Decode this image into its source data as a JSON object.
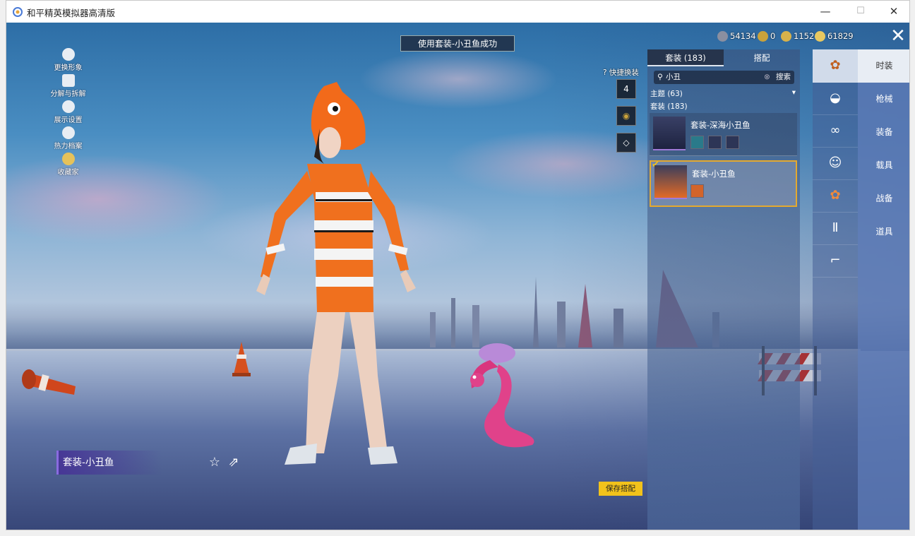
{
  "window": {
    "title": "和平精英模拟器高清版",
    "minimize": "—",
    "maximize": "☐",
    "close": "✕"
  },
  "side_menu": [
    {
      "label": "更换形象",
      "icon": "person-icon"
    },
    {
      "label": "分解与拆解",
      "icon": "puzzle-icon"
    },
    {
      "label": "展示设置",
      "icon": "eye-icon"
    },
    {
      "label": "热力档案",
      "icon": "flame-icon"
    },
    {
      "label": "收藏家",
      "icon": "medal-icon"
    }
  ],
  "notice": "使用套装-小丑鱼成功",
  "currencies": [
    {
      "value": "54134",
      "color": "#8a8fa0"
    },
    {
      "value": "0",
      "color": "#c9a23a"
    },
    {
      "value": "1152",
      "color": "#d8b24a"
    },
    {
      "value": "61829",
      "color": "#e8c860"
    }
  ],
  "quick_swap": {
    "label": "快捷换装",
    "slot1": "4"
  },
  "panel": {
    "tabs": [
      "套装 (183)",
      "搭配"
    ],
    "search_value": "小丑",
    "search_button": "搜索",
    "theme_filter": "主题 (63)",
    "suit_count": "套装 (183)",
    "items": [
      {
        "name": "套装-深海小丑鱼"
      },
      {
        "name": "套装-小丑鱼"
      }
    ]
  },
  "categories": [
    "suit-icon",
    "hat-icon",
    "glasses-icon",
    "mask-icon",
    "top-icon",
    "pants-icon",
    "shoes-icon"
  ],
  "nav": [
    "时装",
    "枪械",
    "装备",
    "载具",
    "战备",
    "道具"
  ],
  "outfit_name": "套装-小丑鱼",
  "save_button": "保存搭配"
}
